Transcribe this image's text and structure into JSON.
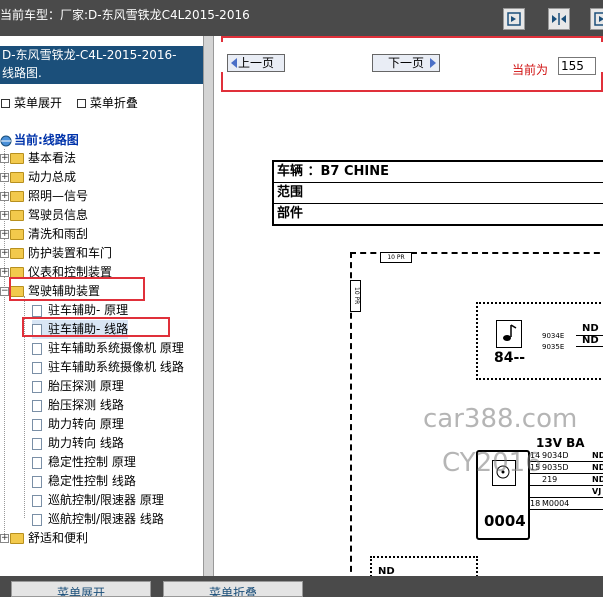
{
  "titlebar": {
    "title": "当前车型：厂家:D-东风雪铁龙C4L2015-2016"
  },
  "sidebar": {
    "doc_title_line1": "D-东风雪铁龙-C4L-2015-2016-",
    "doc_title_line2": "线路图.",
    "expand_all": "菜单展开",
    "collapse_all": "菜单折叠",
    "root_label": "当前:线路图",
    "folders": [
      "基本看法",
      "动力总成",
      "照明—信号",
      "驾驶员信息",
      "清洗和雨刮",
      "防护装置和车门",
      "仪表和控制装置",
      "驾驶辅助装置"
    ],
    "children": [
      "驻车辅助- 原理",
      "驻车辅助- 线路",
      "驻车辅助系统摄像机 原理",
      "驻车辅助系统摄像机 线路",
      "胎压探测 原理",
      "胎压探测 线路",
      "助力转向 原理",
      "助力转向 线路",
      "稳定性控制 原理",
      "稳定性控制 线路",
      "巡航控制/限速器 原理",
      "巡航控制/限速器 线路"
    ],
    "last_folder": "舒适和便利"
  },
  "viewer": {
    "prev_label": "上一页",
    "next_label": "下一页",
    "current_label": "当前为",
    "current_page": "155",
    "table_rows": [
      "车辆 ：B7 CHINE",
      "范围",
      "部件"
    ],
    "frame_tag": "10 PR",
    "frame_side_tag": "10 PR",
    "box1_id": "84--",
    "box1_pins": [
      "9034E",
      "9035E"
    ],
    "box1_nd": [
      "ND",
      "ND"
    ],
    "box2_header": "13V BA",
    "box2_id": "0004",
    "box2_rows": [
      {
        "pin": "14",
        "wire": "9034D",
        "end": "ND"
      },
      {
        "pin": "15",
        "wire": "9035D",
        "end": "ND"
      },
      {
        "pin": "",
        "wire": "219",
        "end": "ND"
      },
      {
        "pin": "",
        "wire": "",
        "end": "VJ"
      },
      {
        "pin": "18",
        "wire": "M0004",
        "end": ""
      }
    ],
    "box3_nd": "ND",
    "watermark1": "car388.com",
    "watermark2": "CY2016"
  },
  "bottom": {
    "expand_button": "菜单展开",
    "collapse_button": "菜单折叠"
  },
  "colors": {
    "titlebar": "#4a4a4a",
    "doc_title_bg": "#1b4f7a",
    "highlight": "#e0303a"
  }
}
